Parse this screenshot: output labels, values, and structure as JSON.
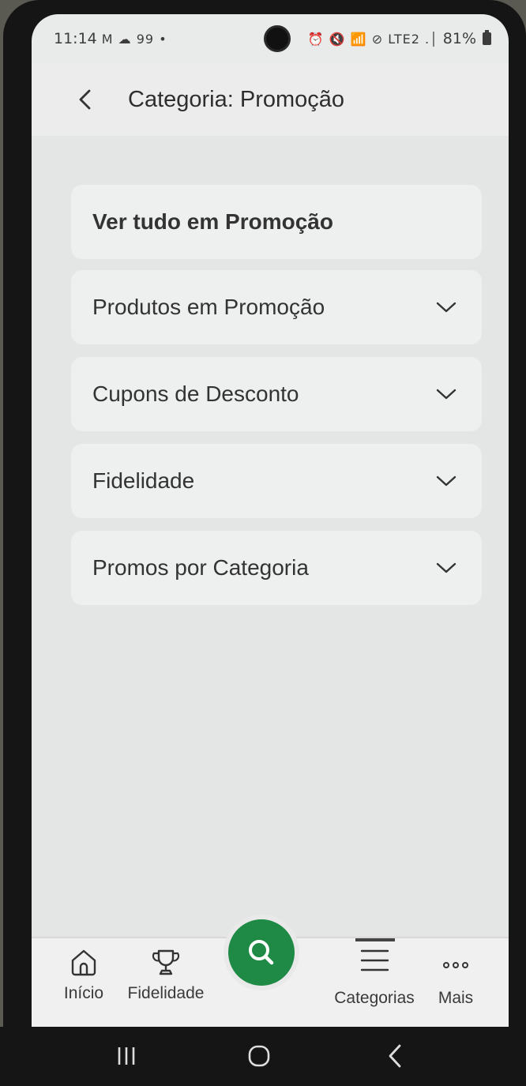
{
  "status_bar": {
    "time": "11:14",
    "notification_icons": "M ☁ 99 •",
    "system_icons": "⏰ 🔇 📶 ⊘ LTE2 .│",
    "battery": "81%"
  },
  "header": {
    "title": "Categoria: Promoção",
    "back_icon": "chevron-left-icon"
  },
  "menu": {
    "items": [
      {
        "label": "Ver tudo em Promoção",
        "expandable": false
      },
      {
        "label": "Produtos em Promoção",
        "expandable": true
      },
      {
        "label": "Cupons de Desconto",
        "expandable": true
      },
      {
        "label": "Fidelidade",
        "expandable": true
      },
      {
        "label": "Promos por Categoria",
        "expandable": true
      }
    ]
  },
  "bottom_nav": {
    "items": [
      {
        "label": "Início",
        "icon": "home-icon"
      },
      {
        "label": "Fidelidade",
        "icon": "trophy-icon"
      },
      {
        "label": "Categorias",
        "icon": "list-icon",
        "active": true
      },
      {
        "label": "Mais",
        "icon": "more-dots-icon"
      }
    ],
    "fab_icon": "search-icon",
    "fab_color": "#1e8a45"
  },
  "system_nav": {
    "recent_icon": "recent-apps-icon",
    "home_icon": "home-circle-icon",
    "back_icon": "back-arrow-icon"
  }
}
